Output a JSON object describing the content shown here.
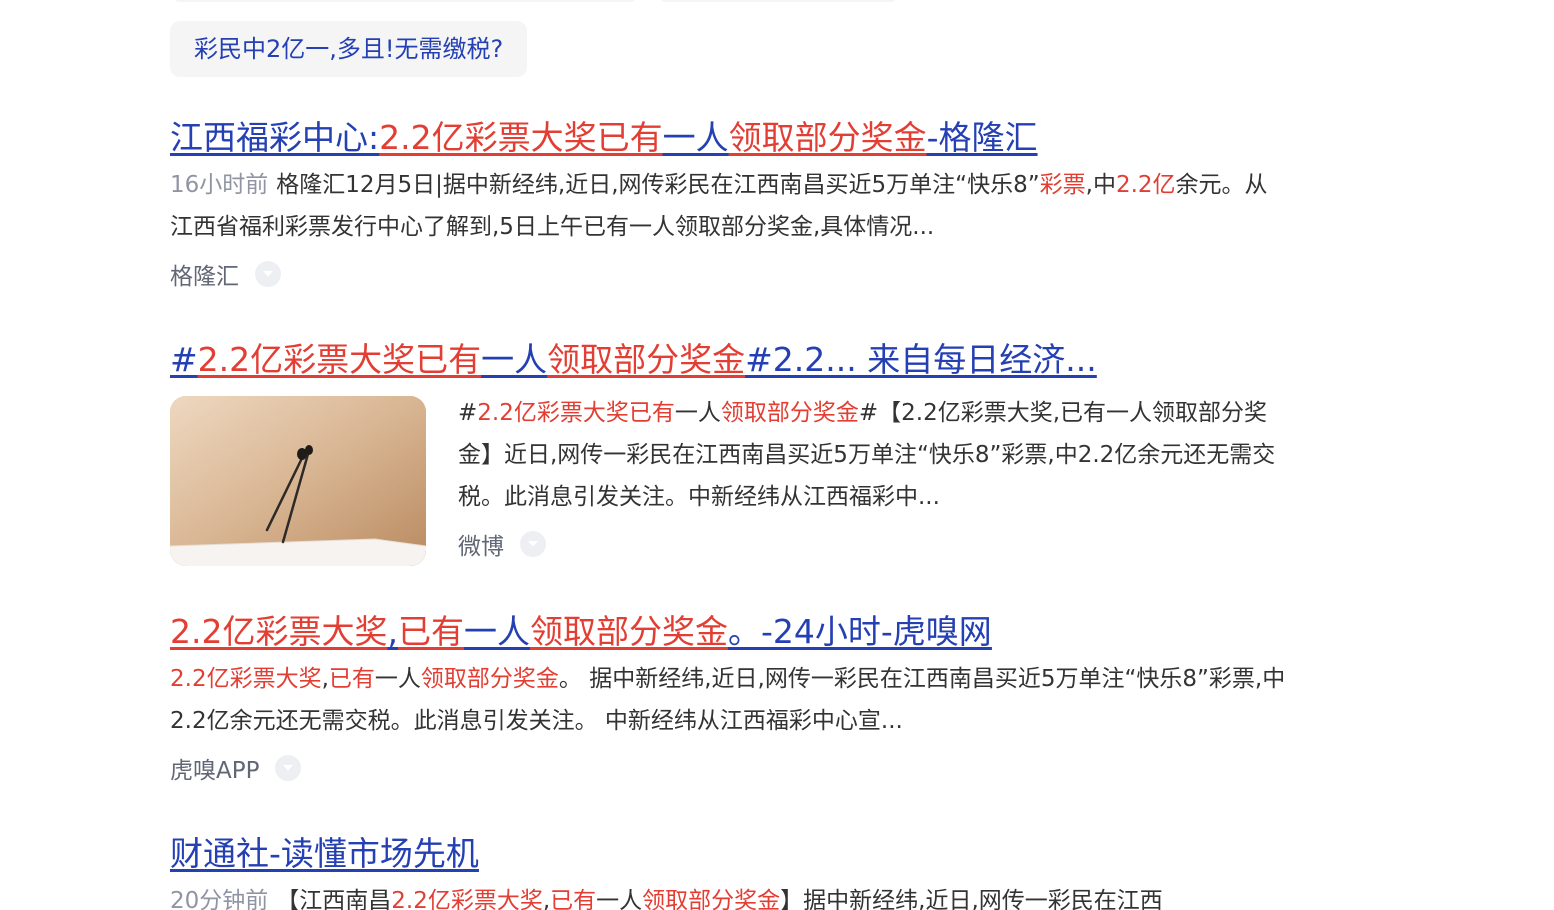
{
  "related_query": "彩民中2亿一,多且!无需缴税?",
  "results": [
    {
      "title": [
        {
          "t": "江西福彩中心:",
          "hl": false
        },
        {
          "t": "2.2亿彩票大奖已有",
          "hl": true
        },
        {
          "t": "一人",
          "hl": false
        },
        {
          "t": "领取部分奖金",
          "hl": true
        },
        {
          "t": "-格隆汇",
          "hl": false
        }
      ],
      "time": "16小时前",
      "abstract": [
        {
          "t": "格隆汇12月5日|据中新经纬,近日,网传彩民在江西南昌买近5万单注“快乐8”",
          "hl": false
        },
        {
          "t": "彩票",
          "hl": true
        },
        {
          "t": ",中",
          "hl": false
        },
        {
          "t": "2.2亿",
          "hl": true
        },
        {
          "t": "余元。从江西省福利彩票发行中心了解到,5日上午已有一人领取部分奖金,具体情况...",
          "hl": false
        }
      ],
      "source": "格隆汇"
    },
    {
      "title": [
        {
          "t": "#",
          "hl": false
        },
        {
          "t": "2.2亿彩票大奖已有",
          "hl": true
        },
        {
          "t": "一人",
          "hl": false
        },
        {
          "t": "领取部分奖金",
          "hl": true
        },
        {
          "t": "#2.2... 来自每日经济...",
          "hl": false
        }
      ],
      "abstract": [
        {
          "t": "#",
          "hl": false
        },
        {
          "t": "2.2亿彩票大奖已有",
          "hl": true
        },
        {
          "t": "一人",
          "hl": false
        },
        {
          "t": "领取部分奖金",
          "hl": true
        },
        {
          "t": "#【2.2亿彩票大奖,已有一人领取部分奖金】近日,网传一彩民在江西南昌买近5万单注“快乐8”彩票,中2.2亿余元还无需交税。此消息引发关注。中新经纬从江西福彩中...",
          "hl": false
        }
      ],
      "source": "微博"
    },
    {
      "title": [
        {
          "t": "2.2亿彩票大奖",
          "hl": true
        },
        {
          "t": ",",
          "hl": false
        },
        {
          "t": "已有",
          "hl": true
        },
        {
          "t": "一人",
          "hl": false
        },
        {
          "t": "领取部分奖金",
          "hl": true
        },
        {
          "t": "。-24小时-虎嗅网",
          "hl": false
        }
      ],
      "abstract": [
        {
          "t": "2.2亿彩票大奖",
          "hl": true
        },
        {
          "t": ",",
          "hl": false
        },
        {
          "t": "已有",
          "hl": true
        },
        {
          "t": "一人",
          "hl": false
        },
        {
          "t": "领取部分奖金",
          "hl": true
        },
        {
          "t": "。 据中新经纬,近日,网传一彩民在江西南昌买近5万单注“快乐8”彩票,中2.2亿余元还无需交税。此消息引发关注。 中新经纬从江西福彩中心宣...",
          "hl": false
        }
      ],
      "source": "虎嗅APP"
    },
    {
      "title": [
        {
          "t": "财通社-读懂市场先机",
          "hl": false
        }
      ],
      "time": "20分钟前",
      "abstract": [
        {
          "t": "【江西南昌",
          "hl": false
        },
        {
          "t": "2.2亿彩票大奖",
          "hl": true
        },
        {
          "t": ",",
          "hl": false
        },
        {
          "t": "已有",
          "hl": true
        },
        {
          "t": "一人",
          "hl": false
        },
        {
          "t": "领取部分奖金",
          "hl": true
        },
        {
          "t": "】据中新经纬,近日,网传一彩民在江西",
          "hl": false
        }
      ]
    }
  ],
  "colors": {
    "link": "#2440b3",
    "highlight": "#e33e33",
    "text": "#333333",
    "meta": "#9195a3",
    "source": "#626675",
    "chip_bg": "#f5f5f6"
  },
  "icons": {
    "dropdown": "chevron-down-icon"
  }
}
